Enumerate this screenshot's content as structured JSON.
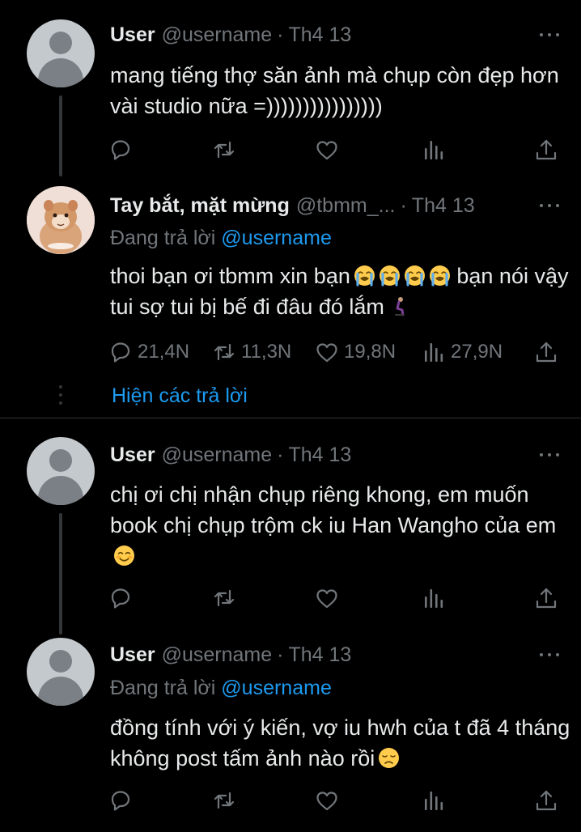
{
  "colors": {
    "background": "#000000",
    "text_primary": "#e7e9ea",
    "text_secondary": "#71767b",
    "accent": "#1d9bf0",
    "divider": "#2f3336"
  },
  "tweets": [
    {
      "name": "User",
      "handle": "@username",
      "separator": "·",
      "date": "Th4 13",
      "text": "mang tiếng thợ săn ảnh mà chụp còn đẹp hơn vài studio nữa =))))))))))))))))",
      "avatar_icon": "default-avatar-icon"
    },
    {
      "name": "Tay bắt, mặt mừng",
      "handle": "@tbmm_...",
      "separator": "·",
      "date": "Th4 13",
      "replying_label": "Đang trả lời",
      "replying_to": "@username",
      "text_a": "thoi bạn ơi tbmm xin bạn",
      "text_b": "bạn nói vậy tui sợ tui bị bế đi đâu đó lắm",
      "emojis": [
        "loudly-crying-face-icon",
        "loudly-crying-face-icon",
        "loudly-crying-face-icon",
        "loudly-crying-face-icon",
        "person-kneeling-icon"
      ],
      "avatar_icon": "hamster-avatar-icon",
      "counts": {
        "reply": "21,4N",
        "retweet": "11,3N",
        "like": "19,8N",
        "views": "27,9N"
      },
      "show_replies": "Hiện các trả lời"
    },
    {
      "name": "User",
      "handle": "@username",
      "separator": "·",
      "date": "Th4 13",
      "text": "chị ơi chị nhận chụp riêng khong, em muốn book chị chụp trộm ck iu Han Wangho của em",
      "emoji": "smiling-face-icon",
      "avatar_icon": "default-avatar-icon"
    },
    {
      "name": "User",
      "handle": "@username",
      "separator": "·",
      "date": "Th4 13",
      "replying_label": "Đang trả lời",
      "replying_to": "@username",
      "text": "đồng tính với ý kiến, vợ iu hwh của t đã 4 tháng không post tấm ảnh nào rồi",
      "emoji": "disappointed-face-icon",
      "avatar_icon": "default-avatar-icon"
    }
  ],
  "action_icons": [
    "reply-icon",
    "retweet-icon",
    "like-icon",
    "views-icon",
    "share-icon"
  ]
}
